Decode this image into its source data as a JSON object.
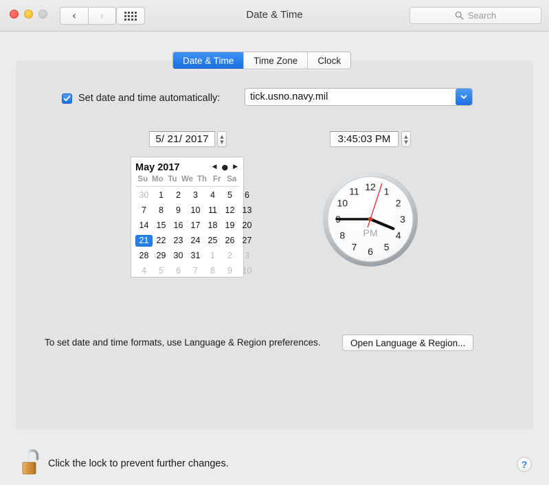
{
  "window": {
    "title": "Date & Time",
    "traffic_lights": [
      "close",
      "minimize",
      "zoom"
    ],
    "nav_back_icon": "‹",
    "nav_forward_icon": "›",
    "grid_icon": "grid-icon"
  },
  "search": {
    "placeholder": "Search",
    "value": ""
  },
  "tabs": [
    {
      "label": "Date & Time",
      "active": true
    },
    {
      "label": "Time Zone",
      "active": false
    },
    {
      "label": "Clock",
      "active": false
    }
  ],
  "auto_set": {
    "checked": true,
    "label": "Set date and time automatically:",
    "server_value": "tick.usno.navy.mil",
    "dropdown_icon": "chevron-down-icon"
  },
  "date_field": {
    "value": "5/ 21/ 2017",
    "stepper_up": "▲",
    "stepper_down": "▼"
  },
  "time_field": {
    "value": "3:45:03 PM",
    "stepper_up": "▲",
    "stepper_down": "▼"
  },
  "calendar": {
    "month_label": "May 2017",
    "prev_icon": "◀",
    "today_icon": "●",
    "next_icon": "▶",
    "weekdays": [
      "Su",
      "Mo",
      "Tu",
      "We",
      "Th",
      "Fr",
      "Sa"
    ],
    "selected_day": 21,
    "weeks": [
      [
        {
          "d": "30",
          "muted": true
        },
        {
          "d": "1"
        },
        {
          "d": "2"
        },
        {
          "d": "3"
        },
        {
          "d": "4"
        },
        {
          "d": "5"
        },
        {
          "d": "6"
        }
      ],
      [
        {
          "d": "7"
        },
        {
          "d": "8"
        },
        {
          "d": "9"
        },
        {
          "d": "10"
        },
        {
          "d": "11"
        },
        {
          "d": "12"
        },
        {
          "d": "13"
        }
      ],
      [
        {
          "d": "14"
        },
        {
          "d": "15"
        },
        {
          "d": "16"
        },
        {
          "d": "17"
        },
        {
          "d": "18"
        },
        {
          "d": "19"
        },
        {
          "d": "20"
        }
      ],
      [
        {
          "d": "21",
          "selected": true
        },
        {
          "d": "22"
        },
        {
          "d": "23"
        },
        {
          "d": "24"
        },
        {
          "d": "25"
        },
        {
          "d": "26"
        },
        {
          "d": "27"
        }
      ],
      [
        {
          "d": "28"
        },
        {
          "d": "29"
        },
        {
          "d": "30"
        },
        {
          "d": "31"
        },
        {
          "d": "1",
          "muted": true
        },
        {
          "d": "2",
          "muted": true
        },
        {
          "d": "3",
          "muted": true
        }
      ],
      [
        {
          "d": "4",
          "muted": true
        },
        {
          "d": "5",
          "muted": true
        },
        {
          "d": "6",
          "muted": true
        },
        {
          "d": "7",
          "muted": true
        },
        {
          "d": "8",
          "muted": true
        },
        {
          "d": "9",
          "muted": true
        },
        {
          "d": "10",
          "muted": true
        }
      ]
    ]
  },
  "clock": {
    "hour_numerals": [
      "12",
      "1",
      "2",
      "3",
      "4",
      "5",
      "6",
      "7",
      "8",
      "9",
      "10",
      "11"
    ],
    "meridiem_label": "PM",
    "hour": 3,
    "minute": 45,
    "second": 3,
    "hour_hand_angle": 112.5,
    "minute_hand_angle": 270,
    "second_hand_angle": 18,
    "second_hand_color": "#ee2222"
  },
  "formats": {
    "text": "To set date and time formats, use Language & Region preferences.",
    "button_label": "Open Language & Region..."
  },
  "footer": {
    "lock_icon": "unlocked-padlock-icon",
    "lock_text": "Click the lock to prevent further changes.",
    "help_label": "?"
  },
  "colors": {
    "accent_blue": "#2580e8",
    "window_bg": "#ececec",
    "panel_bg": "#e3e3e3",
    "second_hand": "#ee2222"
  }
}
